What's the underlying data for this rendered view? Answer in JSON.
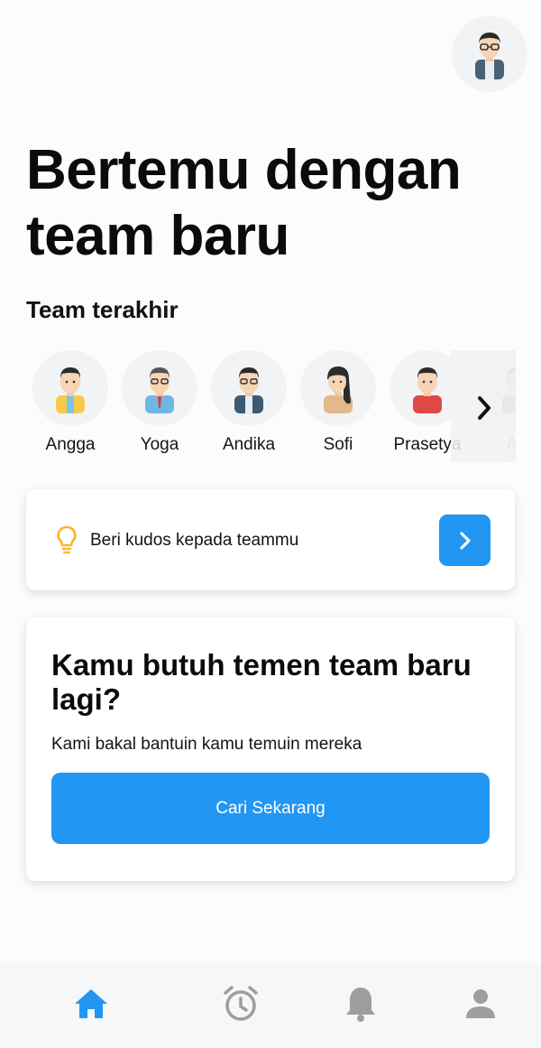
{
  "header": {
    "profile_icon": "avatar-icon"
  },
  "hero": {
    "line1": "Bertemu dengan",
    "line2": "team baru"
  },
  "recent_team": {
    "title": "Team terakhir",
    "members": [
      {
        "name": "Angga",
        "icon": "avatar-angga"
      },
      {
        "name": "Yoga",
        "icon": "avatar-yoga"
      },
      {
        "name": "Andika",
        "icon": "avatar-andika"
      },
      {
        "name": "Sofi",
        "icon": "avatar-sofi"
      },
      {
        "name": "Prasetya",
        "icon": "avatar-prasetya"
      },
      {
        "name": "Ad",
        "icon": "avatar-partial"
      }
    ],
    "scroll_icon": "chevron-right-icon"
  },
  "kudos_card": {
    "text": "Beri kudos kepada teammu",
    "icon": "lightbulb-icon",
    "button_icon": "chevron-right-icon"
  },
  "promo_card": {
    "title": "Kamu butuh temen team baru lagi?",
    "subtitle": "Kami bakal bantuin kamu temuin mereka",
    "cta_label": "Cari Sekarang"
  },
  "bottom_nav": {
    "items": [
      {
        "name": "home",
        "icon": "home-icon",
        "active": true
      },
      {
        "name": "alarm",
        "icon": "alarm-icon",
        "active": false
      },
      {
        "name": "notifications",
        "icon": "bell-icon",
        "active": false
      },
      {
        "name": "profile",
        "icon": "person-icon",
        "active": false
      }
    ]
  },
  "colors": {
    "accent": "#2196f3",
    "bulb": "#f5b82e",
    "nav_inactive": "#9e9e9e",
    "background": "#fbfcfd"
  }
}
